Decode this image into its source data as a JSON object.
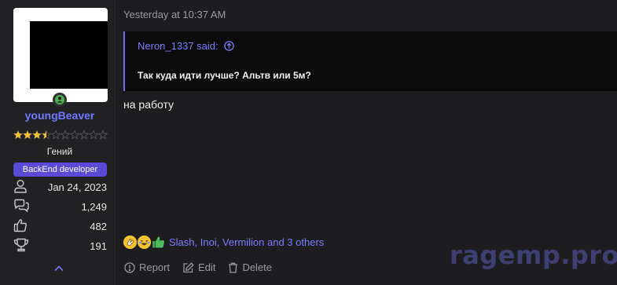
{
  "user": {
    "username": "youngBeaver",
    "rank_title": "Гений",
    "badge": "BackEnd developer",
    "rating": 3.5,
    "rating_max": 10,
    "stats": [
      {
        "icon": "user-icon",
        "value": "Jan 24, 2023"
      },
      {
        "icon": "messages-icon",
        "value": "1,249"
      },
      {
        "icon": "thumbs-up-icon",
        "value": "482"
      },
      {
        "icon": "trophy-icon",
        "value": "191"
      }
    ]
  },
  "post": {
    "timestamp": "Yesterday at 10:37 AM",
    "quote": {
      "author": "Neron_1337 said:",
      "text": "Так куда идти лучше? Альтв или 5м?"
    },
    "message": "на работу",
    "reactions": {
      "users": "Slash, Inoi, Vermilion and 3 others"
    },
    "actions": {
      "report": "Report",
      "edit": "Edit",
      "delete": "Delete"
    }
  },
  "watermark": "ragemp.pro",
  "colors": {
    "accent": "#6f79ff",
    "badge": "#5a4bd6",
    "star": "#f3c233",
    "online": "#4caf50"
  }
}
